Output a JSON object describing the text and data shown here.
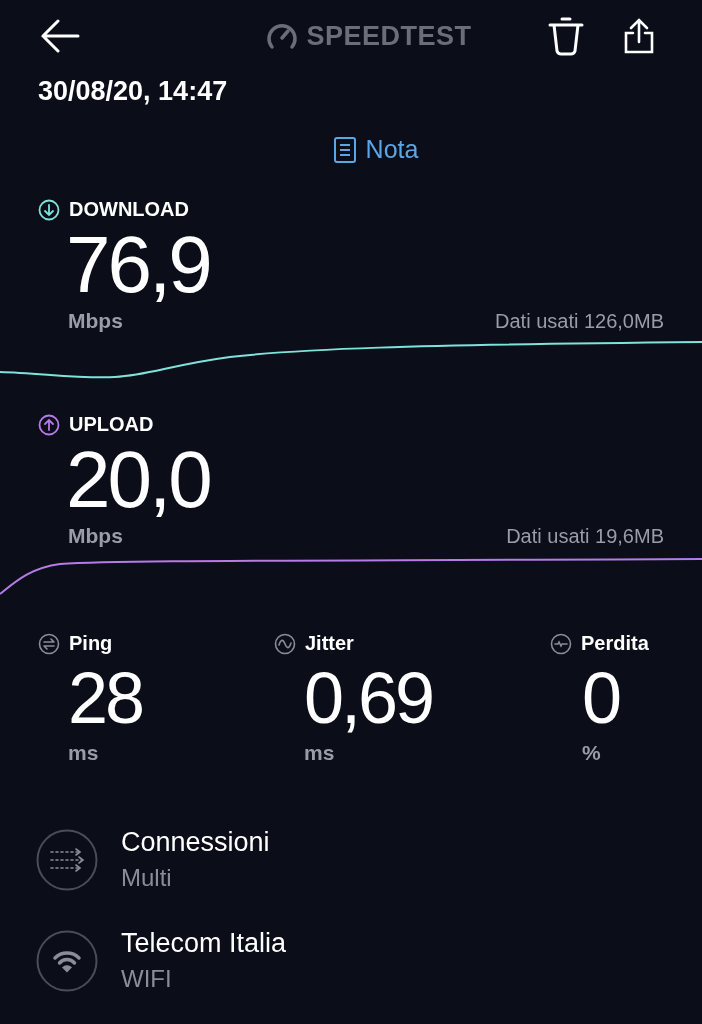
{
  "header": {
    "logo_text": "SPEEDTEST",
    "date": "30/08/20, 14:47",
    "note": "Nota"
  },
  "tests": [
    {
      "kind": "download",
      "label": "DOWNLOAD",
      "value": "76,9",
      "unit": "Mbps",
      "data_used": "Dati usati 126,0MB",
      "color": "#7fe3dc"
    },
    {
      "kind": "upload",
      "label": "UPLOAD",
      "value": "20,0",
      "unit": "Mbps",
      "data_used": "Dati usati 19,6MB",
      "color": "#b57be6"
    }
  ],
  "metrics": [
    {
      "kind": "ping",
      "label": "Ping",
      "value": "28",
      "unit": "ms"
    },
    {
      "kind": "jitter",
      "label": "Jitter",
      "value": "0,69",
      "unit": "ms"
    },
    {
      "kind": "loss",
      "label": "Perdita",
      "value": "0",
      "unit": "%"
    }
  ],
  "connections": [
    {
      "kind": "multi",
      "title": "Connessioni",
      "subtitle": "Multi"
    },
    {
      "kind": "wifi",
      "title": "Telecom Italia",
      "subtitle": "WIFI"
    }
  ]
}
